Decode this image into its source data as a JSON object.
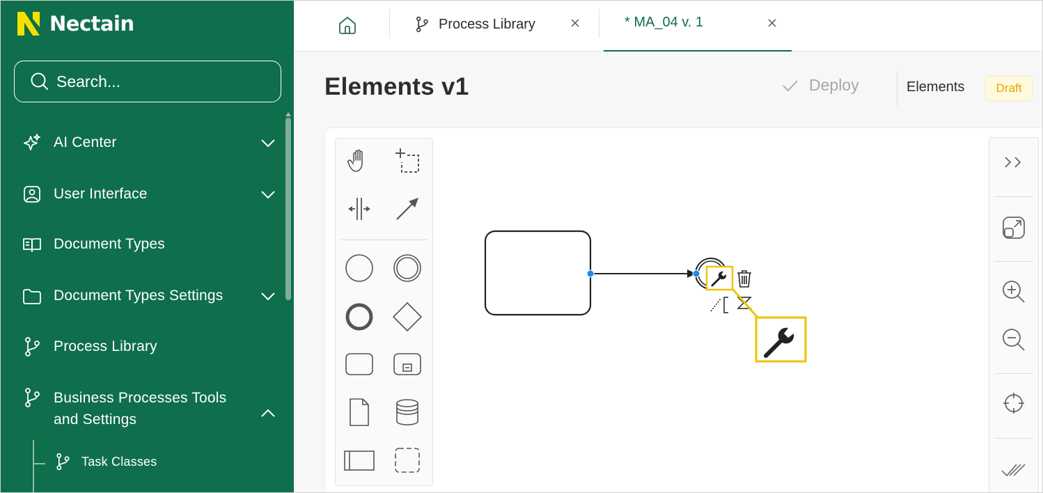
{
  "app": {
    "brand": "Nectain",
    "brand_color": "#0f6e4c",
    "logo_color": "#f5e000"
  },
  "search": {
    "placeholder": "Search..."
  },
  "sidebar": {
    "items": [
      {
        "label": "AI Center",
        "icon": "sparkles-icon",
        "chevron": "down"
      },
      {
        "label": "User Interface",
        "icon": "image-icon",
        "chevron": "down"
      },
      {
        "label": "Document Types",
        "icon": "book-icon",
        "chevron": "none"
      },
      {
        "label": "Document Types Settings",
        "icon": "folder-icon",
        "chevron": "down"
      },
      {
        "label": "Process Library",
        "icon": "branch-icon",
        "chevron": "none"
      },
      {
        "label": "Business Processes Tools and Settings",
        "icon": "branch-icon",
        "chevron": "up"
      }
    ],
    "sub_items": [
      {
        "label": "Task Classes",
        "icon": "branch-icon"
      }
    ]
  },
  "tabs": [
    {
      "label": "",
      "icon": "home-icon"
    },
    {
      "label": "Process Library",
      "icon": "branch-icon",
      "closable": true
    },
    {
      "label": "* MA_04 v. 1",
      "closable": true,
      "active": true
    }
  ],
  "header": {
    "title": "Elements v1",
    "deploy_label": "Deploy",
    "elements_label": "Elements",
    "status_badge": "Draft"
  },
  "palette": {
    "tools": [
      "hand-tool-icon",
      "lasso-tool-icon",
      "space-tool-icon",
      "connect-tool-icon",
      "start-event-icon",
      "intermediate-event-icon",
      "end-event-icon",
      "gateway-icon",
      "task-icon",
      "subprocess-icon",
      "data-object-icon",
      "data-store-icon",
      "pool-icon",
      "group-icon"
    ]
  },
  "right_toolbar": {
    "buttons": [
      "expand-panel-icon",
      "fit-view-icon",
      "zoom-in-icon",
      "zoom-out-icon",
      "center-icon",
      "validate-icon"
    ]
  },
  "highlight_color": "#f2c200",
  "selection_color": "#1e88e5"
}
